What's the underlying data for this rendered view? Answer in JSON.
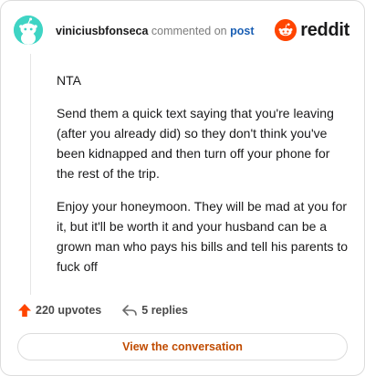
{
  "header": {
    "username": "viniciusbfonseca",
    "action": "commented on",
    "post_link": "post",
    "brand_word": "reddit",
    "avatar_icon": "reddit-snoo-avatar-icon",
    "brand_icon": "reddit-logo-icon"
  },
  "comment": {
    "paragraphs": [
      "NTA",
      "Send them a quick text saying that you're leaving (after you already did) so they don't think you've been kidnapped and then turn off your phone for the rest of the trip.",
      "Enjoy your honeymoon. They will be mad at you for it, but it'll be worth it and your husband can be a grown man who pays his bills and tell his parents to fuck off"
    ]
  },
  "actions": {
    "upvotes": "220 upvotes",
    "replies": "5 replies",
    "upvote_icon": "upvote-arrow-icon",
    "reply_icon": "reply-arrow-icon"
  },
  "cta": {
    "label": "View the conversation"
  },
  "colors": {
    "brand": "#ff4500",
    "avatar_bg": "#3fd4c4",
    "link": "#1a5fb4",
    "cta_text": "#c04b00"
  }
}
